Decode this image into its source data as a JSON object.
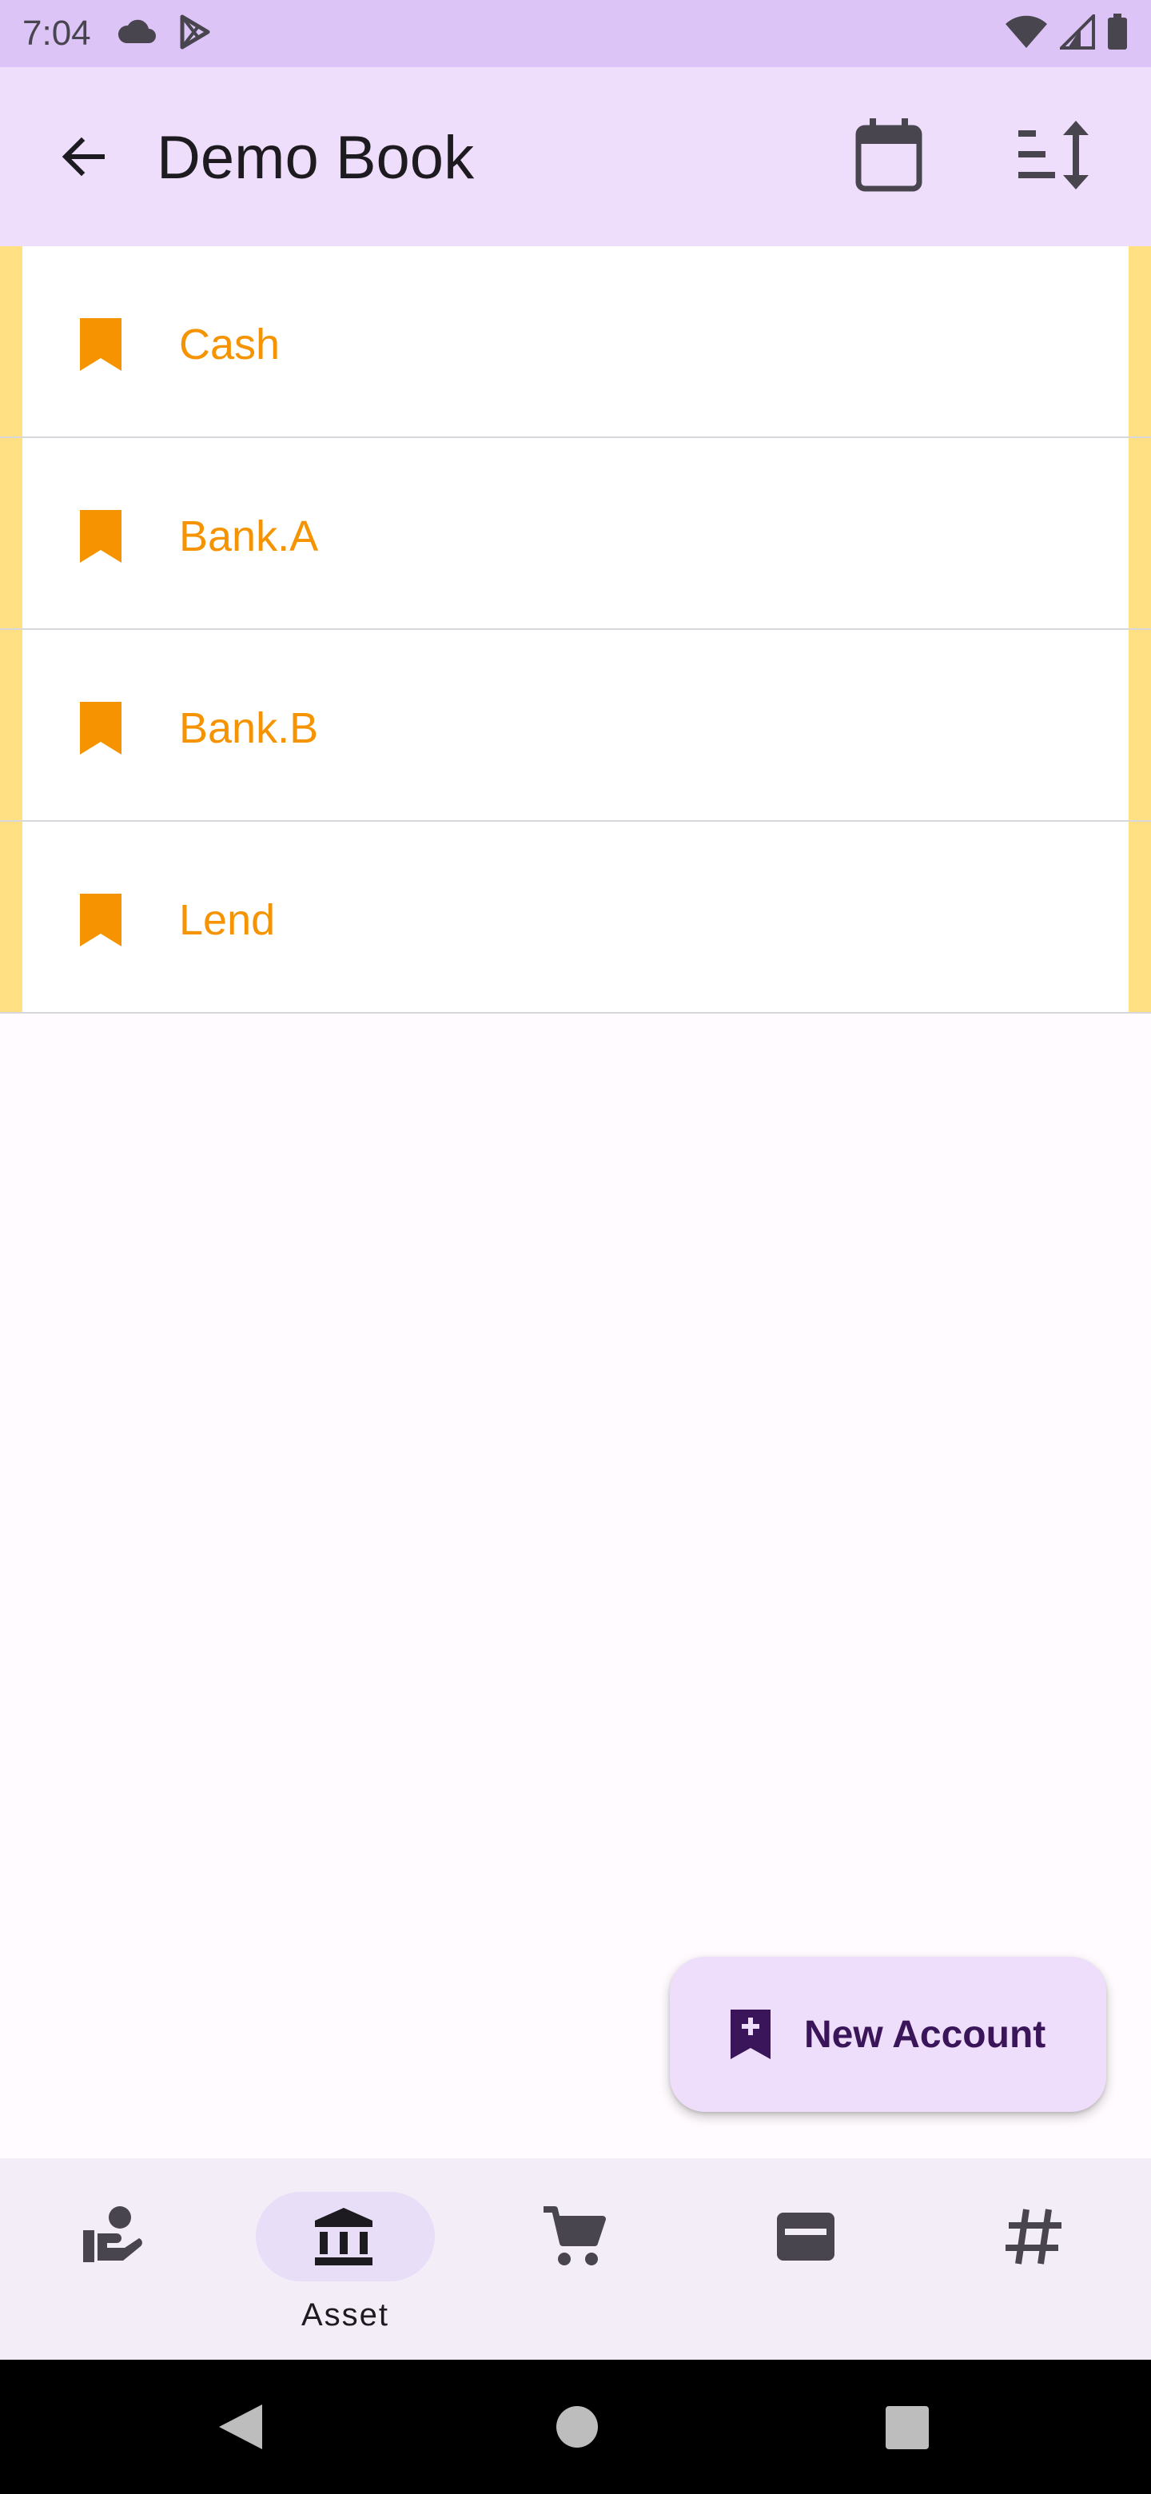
{
  "status_bar": {
    "time": "7:04",
    "left_icons": [
      "cloud-icon",
      "play-store-icon"
    ],
    "right_icons": [
      "wifi-icon",
      "signal-icon",
      "battery-icon"
    ]
  },
  "app_bar": {
    "title": "Demo Book",
    "actions": [
      "calendar-icon",
      "sort-icon"
    ]
  },
  "accounts": [
    {
      "label": "Cash"
    },
    {
      "label": "Bank.A"
    },
    {
      "label": "Bank.B"
    },
    {
      "label": "Lend"
    }
  ],
  "fab": {
    "label": "New Account",
    "icon": "bookmark-add-icon"
  },
  "bottom_nav": {
    "items": [
      {
        "icon": "income-hand-icon",
        "label": ""
      },
      {
        "icon": "bank-icon",
        "label": "Asset",
        "selected": true
      },
      {
        "icon": "cart-icon",
        "label": ""
      },
      {
        "icon": "credit-card-icon",
        "label": ""
      },
      {
        "icon": "hashtag-icon",
        "label": ""
      }
    ]
  },
  "colors": {
    "accent": "#F59300",
    "app_bar": "#EFDEFB",
    "status_bar": "#DCC4F6",
    "item_side_stripe": "#FFE083",
    "fab_text": "#3B1559"
  }
}
